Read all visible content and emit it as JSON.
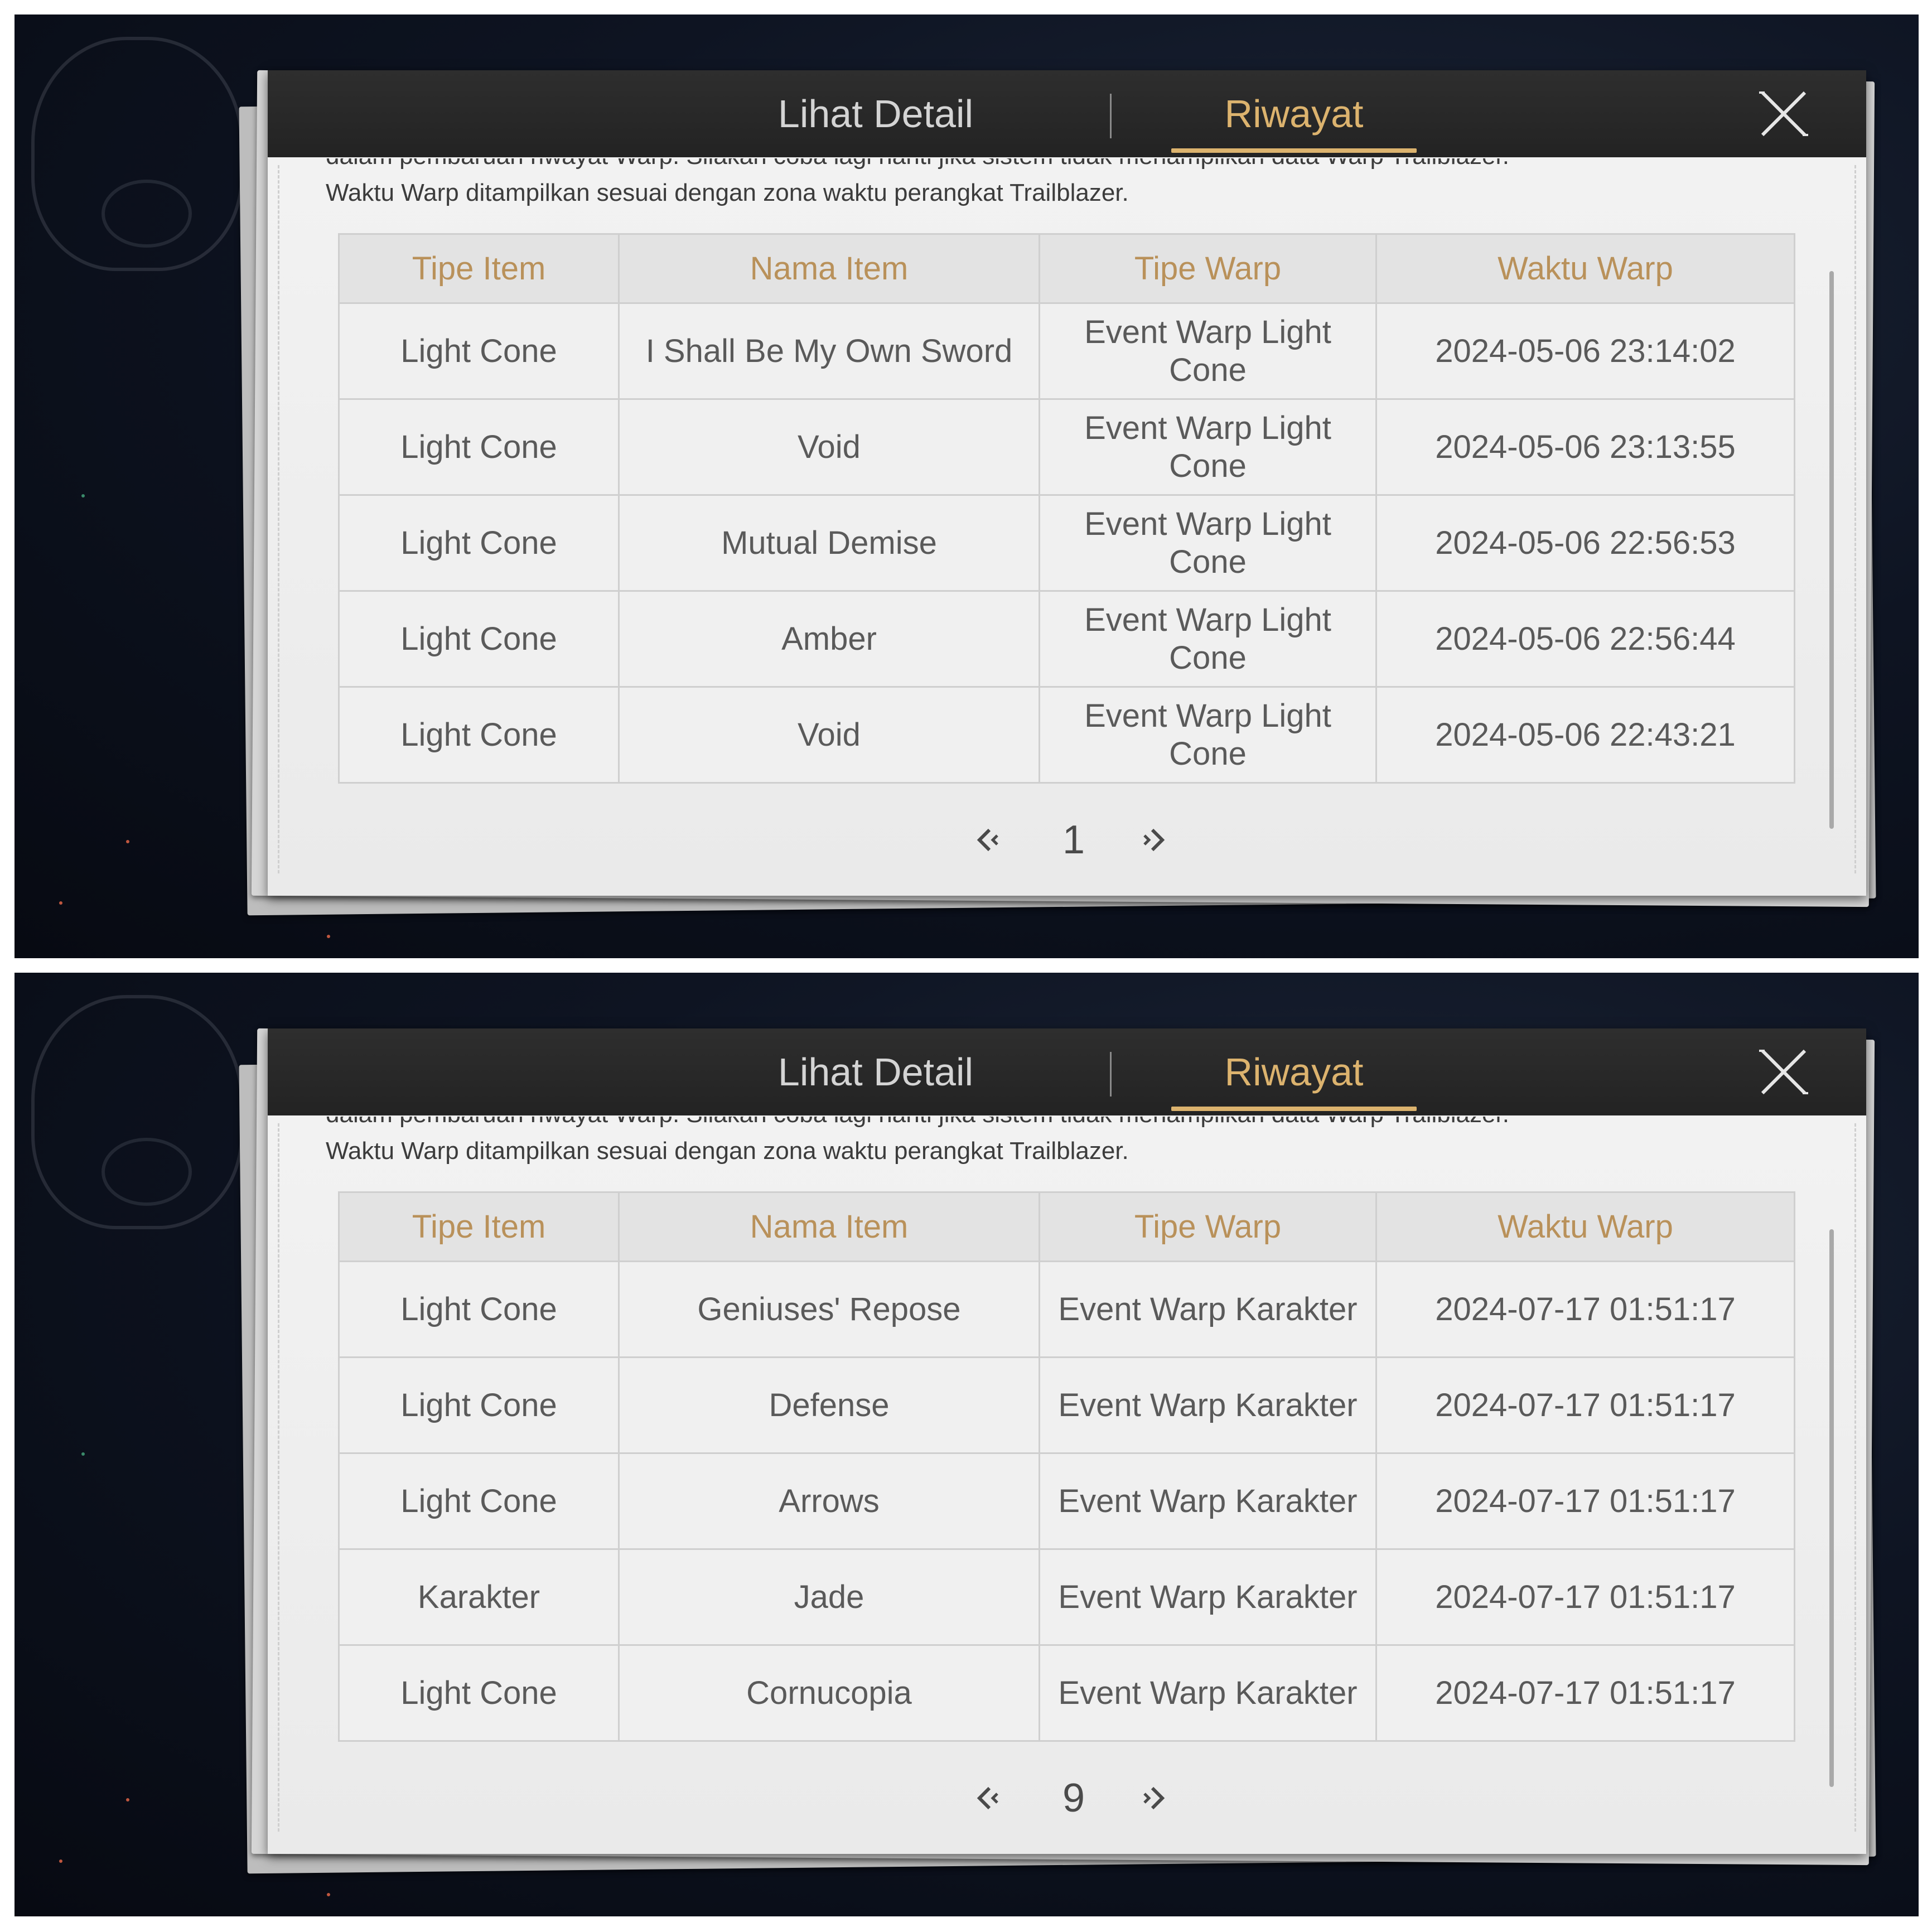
{
  "panels": [
    {
      "tabs": {
        "detail": "Lihat Detail",
        "history": "Riwayat"
      },
      "notice_line1": "dalam pembaruan riwayat Warp. Silakan coba lagi nanti jika sistem tidak menampilkan data Warp Trailblazer.",
      "notice_line2": "Waktu Warp ditampilkan sesuai dengan zona waktu perangkat Trailblazer.",
      "headers": [
        "Tipe Item",
        "Nama Item",
        "Tipe Warp",
        "Waktu Warp"
      ],
      "rows": [
        {
          "tipe_item": "Light Cone",
          "nama_item": "I Shall Be My Own Sword",
          "tipe_warp": "Event Warp Light Cone",
          "waktu_warp": "2024-05-06 23:14:02",
          "rarity_color": "#d2a359"
        },
        {
          "tipe_item": "Light Cone",
          "nama_item": "Void",
          "tipe_warp": "Event Warp Light Cone",
          "waktu_warp": "2024-05-06 23:13:55"
        },
        {
          "tipe_item": "Light Cone",
          "nama_item": "Mutual Demise",
          "tipe_warp": "Event Warp Light Cone",
          "waktu_warp": "2024-05-06 22:56:53"
        },
        {
          "tipe_item": "Light Cone",
          "nama_item": "Amber",
          "tipe_warp": "Event Warp Light Cone",
          "waktu_warp": "2024-05-06 22:56:44"
        },
        {
          "tipe_item": "Light Cone",
          "nama_item": "Void",
          "tipe_warp": "Event Warp Light Cone",
          "waktu_warp": "2024-05-06 22:43:21"
        }
      ],
      "page": "1"
    },
    {
      "tabs": {
        "detail": "Lihat Detail",
        "history": "Riwayat"
      },
      "notice_line1": "dalam pembaruan riwayat Warp. Silakan coba lagi nanti jika sistem tidak menampilkan data Warp Trailblazer.",
      "notice_line2": "Waktu Warp ditampilkan sesuai dengan zona waktu perangkat Trailblazer.",
      "headers": [
        "Tipe Item",
        "Nama Item",
        "Tipe Warp",
        "Waktu Warp"
      ],
      "rows": [
        {
          "tipe_item": "Light Cone",
          "nama_item": "Geniuses' Repose",
          "tipe_warp": "Event Warp Karakter",
          "waktu_warp": "2024-07-17 01:51:17",
          "rarity_color": "#a046d6"
        },
        {
          "tipe_item": "Light Cone",
          "nama_item": "Defense",
          "tipe_warp": "Event Warp Karakter",
          "waktu_warp": "2024-07-17 01:51:17"
        },
        {
          "tipe_item": "Light Cone",
          "nama_item": "Arrows",
          "tipe_warp": "Event Warp Karakter",
          "waktu_warp": "2024-07-17 01:51:17"
        },
        {
          "tipe_item": "Karakter",
          "nama_item": "Jade",
          "tipe_warp": "Event Warp Karakter",
          "waktu_warp": "2024-07-17 01:51:17",
          "rarity_color": "#d2a359"
        },
        {
          "tipe_item": "Light Cone",
          "nama_item": "Cornucopia",
          "tipe_warp": "Event Warp Karakter",
          "waktu_warp": "2024-07-17 01:51:17"
        }
      ],
      "page": "9"
    }
  ],
  "icons": {
    "close": "close-x-icon",
    "prev": "chevron-left-icon",
    "next": "chevron-right-icon"
  },
  "colors": {
    "accent_gold": "#dcb36e",
    "header_text": "#b9915a",
    "rarity_5": "#d2a359",
    "rarity_4": "#a046d6"
  }
}
